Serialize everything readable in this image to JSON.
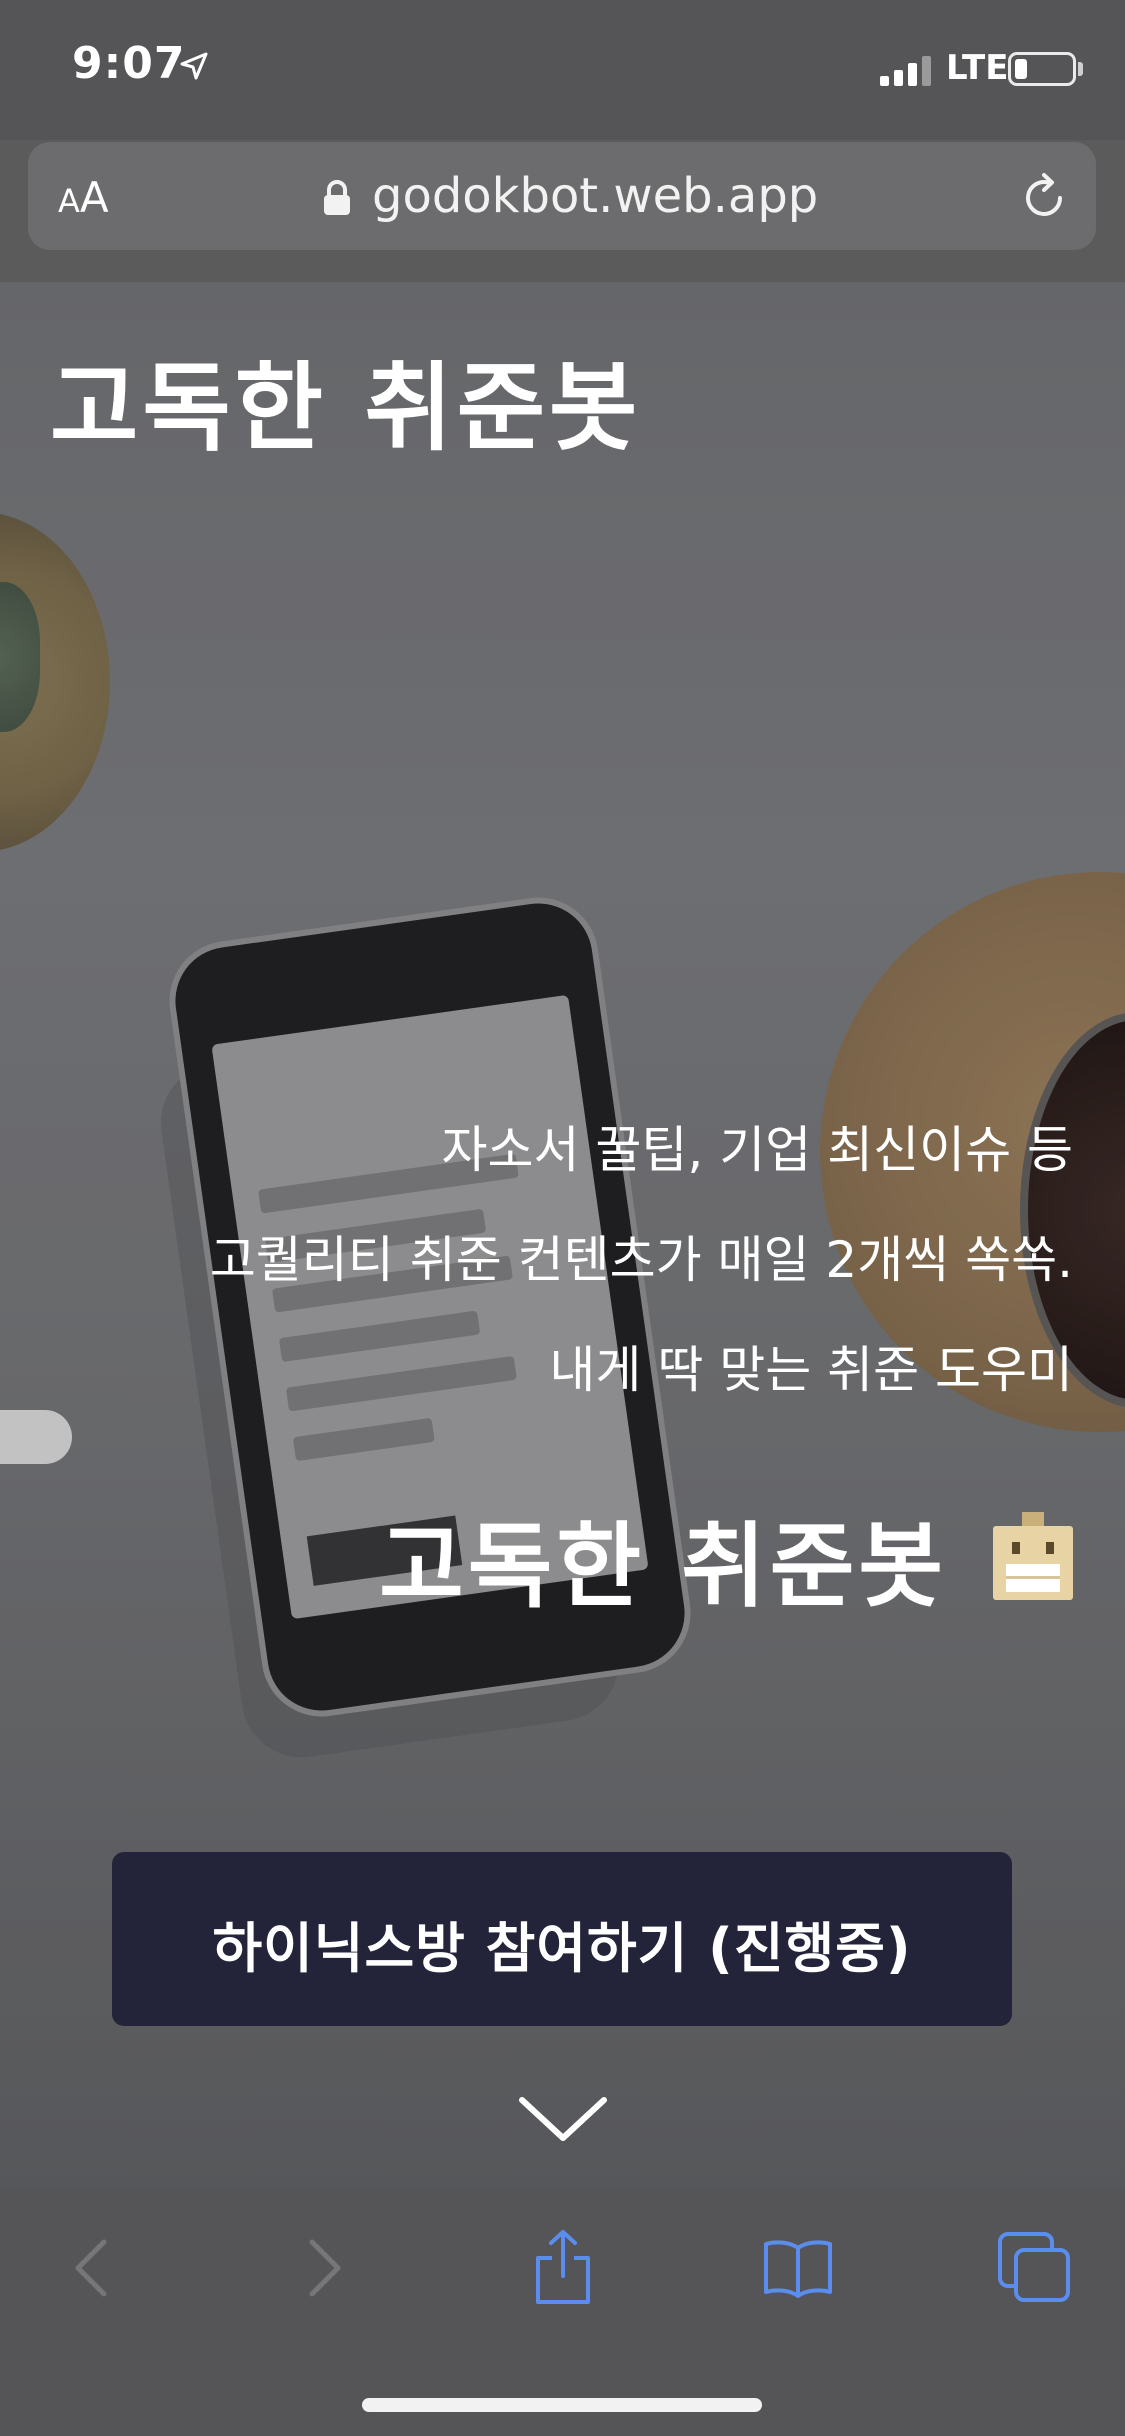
{
  "status_bar": {
    "time": "9:07",
    "network": "LTE",
    "battery_level": 0.15
  },
  "browser": {
    "font_size_button": "AA",
    "url": "godokbot.web.app"
  },
  "hero": {
    "title": "고독한 취준봇",
    "description_lines": [
      "자소서 꿀팁, 기업 최신이슈 등",
      "고퀄리티 취준 컨텐츠가 매일 2개씩 쏙쏙.",
      "내게 딱 맞는 취준 도우미"
    ],
    "brand_name": "고독한 취준봇",
    "join_button": "하이닉스방 참여하기 (진행중)"
  },
  "toolbar": {
    "icons": [
      "back-icon",
      "forward-icon",
      "share-icon",
      "bookmarks-icon",
      "tabs-icon"
    ]
  },
  "colors": {
    "accent": "#5b8def",
    "button_bg": "#23243a",
    "disabled": "#767678"
  }
}
